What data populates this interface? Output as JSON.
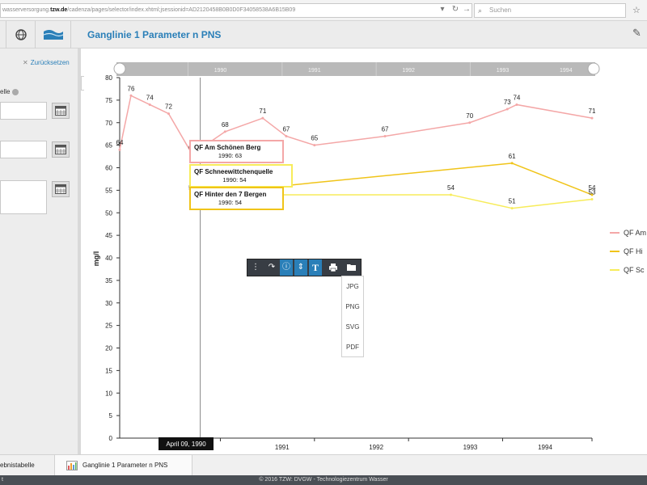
{
  "browser": {
    "url_prefix": "wasserversorgung.",
    "url_domain": "tzw.de",
    "url_path": "/cadenza/pages/selector/index.xhtml;jsessionid=AD2120458B0B0D0F34058538A6B15B09",
    "search_placeholder": "Suchen"
  },
  "header": {
    "title": "Ganglinie 1 Parameter n PNS"
  },
  "sidebar": {
    "reset_label": "Zurücksetzen",
    "field_label": "elle"
  },
  "chart_data": {
    "type": "line",
    "title": "",
    "xlabel": "",
    "ylabel": "mg/l",
    "ylim": [
      0,
      80
    ],
    "yticks": [
      "0",
      "5",
      "10",
      "15",
      "20",
      "25",
      "30",
      "35",
      "40",
      "45",
      "50",
      "55",
      "60",
      "65",
      "70",
      "75",
      "80"
    ],
    "xlim": [
      1989.43,
      1994.45
    ],
    "xticks": [
      {
        "value": 1990.5,
        "label": "1990"
      },
      {
        "value": 1991.5,
        "label": "1991"
      },
      {
        "value": 1992.5,
        "label": "1992"
      },
      {
        "value": 1993.5,
        "label": "1993"
      },
      {
        "value": 1994.5,
        "label": "1994"
      }
    ],
    "grid": false,
    "legend": "right",
    "series": [
      {
        "name": "QF Am Schönen Berg",
        "color": "#f4a7a7",
        "points": [
          {
            "x": 1989.43,
            "y": 64,
            "label": "64"
          },
          {
            "x": 1989.55,
            "y": 76,
            "label": "76"
          },
          {
            "x": 1989.75,
            "y": 74,
            "label": "74"
          },
          {
            "x": 1989.95,
            "y": 72,
            "label": "72"
          },
          {
            "x": 1990.2,
            "y": 63,
            "label": "63"
          },
          {
            "x": 1990.55,
            "y": 68,
            "label": "68"
          },
          {
            "x": 1990.95,
            "y": 71,
            "label": "71"
          },
          {
            "x": 1991.2,
            "y": 67,
            "label": "67"
          },
          {
            "x": 1991.5,
            "y": 65,
            "label": "65"
          },
          {
            "x": 1992.25,
            "y": 67,
            "label": "67"
          },
          {
            "x": 1993.15,
            "y": 70,
            "label": "70"
          },
          {
            "x": 1993.55,
            "y": 73,
            "label": "73"
          },
          {
            "x": 1993.65,
            "y": 74,
            "label": "74"
          },
          {
            "x": 1994.45,
            "y": 71,
            "label": "71"
          }
        ]
      },
      {
        "name": "QF Hinter den 7 Bergen",
        "color": "#f0c419",
        "points": [
          {
            "x": 1990.2,
            "y": 54,
            "label": "54"
          },
          {
            "x": 1993.6,
            "y": 61,
            "label": "61"
          },
          {
            "x": 1994.45,
            "y": 54,
            "label": "54"
          }
        ]
      },
      {
        "name": "QF Schneewittchenquelle",
        "color": "#f7ec5a",
        "points": [
          {
            "x": 1990.2,
            "y": 54,
            "label": ""
          },
          {
            "x": 1992.95,
            "y": 54,
            "label": "54"
          },
          {
            "x": 1993.6,
            "y": 51,
            "label": "51"
          },
          {
            "x": 1994.45,
            "y": 53,
            "label": "53"
          }
        ]
      }
    ],
    "legend_labels": [
      "QF Am",
      "QF Hi",
      "QF Sc"
    ],
    "crosshair": {
      "x": 1990.2,
      "label": "April 09, 1990"
    },
    "tooltips": [
      {
        "title": "QF Am Schönen Berg",
        "value": "1990: 63",
        "color": "#f4a7a7"
      },
      {
        "title": "QF Schneewittchenquelle",
        "value": "1990: 54",
        "color": "#f7ec5a"
      },
      {
        "title": "QF Hinter den 7 Bergen",
        "value": "1990: 54",
        "color": "#f0c419"
      }
    ],
    "navigator_labels": [
      "1990",
      "1991",
      "1992",
      "1993",
      "1994"
    ]
  },
  "export_menu": {
    "items": [
      "JPG",
      "PNG",
      "SVG",
      "PDF"
    ]
  },
  "tabs": [
    {
      "label": "ebnistabelle"
    },
    {
      "label": "Ganglinie 1 Parameter n PNS"
    }
  ],
  "footer": {
    "left": "t",
    "text": "© 2016 TZW: DVGW - Technologiezentrum Wasser"
  }
}
